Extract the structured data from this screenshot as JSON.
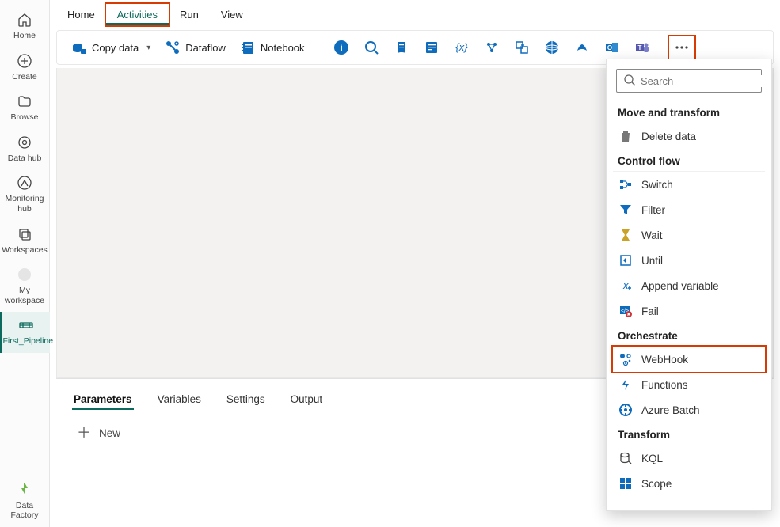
{
  "left_rail": {
    "items": [
      {
        "label": "Home"
      },
      {
        "label": "Create"
      },
      {
        "label": "Browse"
      },
      {
        "label": "Data hub"
      },
      {
        "label": "Monitoring hub"
      },
      {
        "label": "Workspaces"
      },
      {
        "label": "My workspace"
      },
      {
        "label": "First_Pipeline",
        "active": true
      }
    ],
    "footer": {
      "label": "Data Factory"
    }
  },
  "menubar": {
    "items": [
      {
        "label": "Home"
      },
      {
        "label": "Activities",
        "active": true,
        "highlight": true
      },
      {
        "label": "Run"
      },
      {
        "label": "View"
      }
    ]
  },
  "toolbar": {
    "copy": "Copy data",
    "dataflow": "Dataflow",
    "notebook": "Notebook"
  },
  "bottom": {
    "tabs": [
      {
        "label": "Parameters",
        "active": true
      },
      {
        "label": "Variables"
      },
      {
        "label": "Settings"
      },
      {
        "label": "Output"
      }
    ],
    "new_label": "New"
  },
  "flyout": {
    "search_placeholder": "Search",
    "groups": [
      {
        "heading": "Move and transform",
        "items": [
          {
            "icon": "trash",
            "label": "Delete data"
          }
        ]
      },
      {
        "heading": "Control flow",
        "items": [
          {
            "icon": "switch",
            "label": "Switch"
          },
          {
            "icon": "filter",
            "label": "Filter"
          },
          {
            "icon": "wait",
            "label": "Wait"
          },
          {
            "icon": "until",
            "label": "Until"
          },
          {
            "icon": "append",
            "label": "Append variable"
          },
          {
            "icon": "fail",
            "label": "Fail"
          }
        ]
      },
      {
        "heading": "Orchestrate",
        "items": [
          {
            "icon": "webhook",
            "label": "WebHook",
            "highlight": true
          },
          {
            "icon": "functions",
            "label": "Functions"
          },
          {
            "icon": "batch",
            "label": "Azure Batch"
          }
        ]
      },
      {
        "heading": "Transform",
        "items": [
          {
            "icon": "kql",
            "label": "KQL"
          },
          {
            "icon": "scope",
            "label": "Scope"
          }
        ]
      }
    ]
  },
  "colors": {
    "accent": "#0f6cbd",
    "teal": "#0c695d",
    "orange": "#d83b01"
  }
}
